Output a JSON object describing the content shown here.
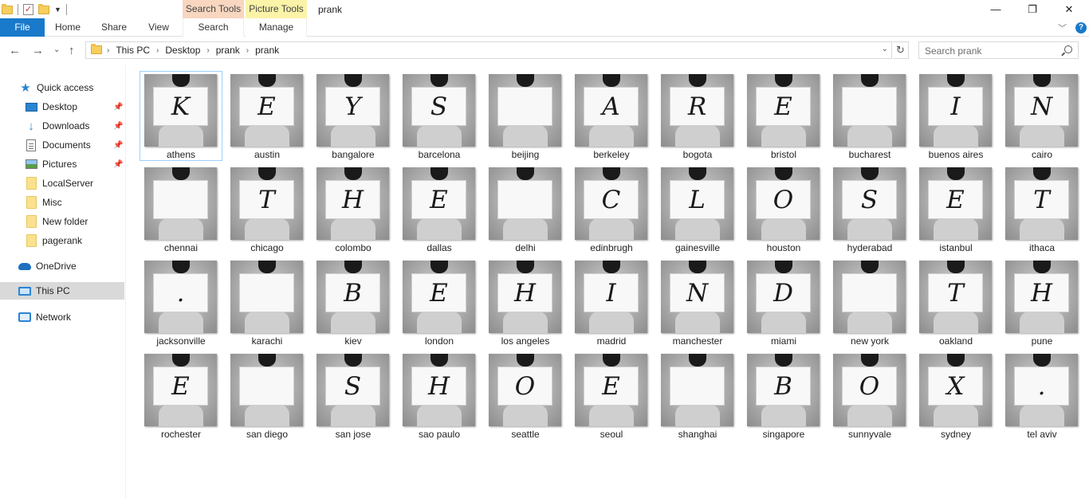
{
  "window": {
    "title": "prank",
    "context_search": "Search Tools",
    "context_picture": "Picture Tools",
    "minimize_icon": "minimize-icon",
    "maximize_icon": "restore-icon",
    "close_icon": "close-icon"
  },
  "ribbon": {
    "tabs": {
      "file": "File",
      "home": "Home",
      "share": "Share",
      "view": "View",
      "search": "Search",
      "manage": "Manage"
    }
  },
  "address": {
    "crumbs": [
      "This PC",
      "Desktop",
      "prank",
      "prank"
    ]
  },
  "search": {
    "placeholder": "Search prank"
  },
  "nav": {
    "quick_access": "Quick access",
    "desktop": "Desktop",
    "downloads": "Downloads",
    "documents": "Documents",
    "pictures": "Pictures",
    "localserver": "LocalServer",
    "misc": "Misc",
    "new_folder": "New folder",
    "pagerank": "pagerank",
    "onedrive": "OneDrive",
    "this_pc": "This PC",
    "network": "Network"
  },
  "files": [
    {
      "name": "athens",
      "letter": "K"
    },
    {
      "name": "austin",
      "letter": "E"
    },
    {
      "name": "bangalore",
      "letter": "Y"
    },
    {
      "name": "barcelona",
      "letter": "S"
    },
    {
      "name": "beijing",
      "letter": ""
    },
    {
      "name": "berkeley",
      "letter": "A"
    },
    {
      "name": "bogota",
      "letter": "R"
    },
    {
      "name": "bristol",
      "letter": "E"
    },
    {
      "name": "bucharest",
      "letter": ""
    },
    {
      "name": "buenos aires",
      "letter": "I"
    },
    {
      "name": "cairo",
      "letter": "N"
    },
    {
      "name": "chennai",
      "letter": ""
    },
    {
      "name": "chicago",
      "letter": "T"
    },
    {
      "name": "colombo",
      "letter": "H"
    },
    {
      "name": "dallas",
      "letter": "E"
    },
    {
      "name": "delhi",
      "letter": ""
    },
    {
      "name": "edinbrugh",
      "letter": "C"
    },
    {
      "name": "gainesville",
      "letter": "L"
    },
    {
      "name": "houston",
      "letter": "O"
    },
    {
      "name": "hyderabad",
      "letter": "S"
    },
    {
      "name": "istanbul",
      "letter": "E"
    },
    {
      "name": "ithaca",
      "letter": "T"
    },
    {
      "name": "jacksonville",
      "letter": "."
    },
    {
      "name": "karachi",
      "letter": ""
    },
    {
      "name": "kiev",
      "letter": "B"
    },
    {
      "name": "london",
      "letter": "E"
    },
    {
      "name": "los angeles",
      "letter": "H"
    },
    {
      "name": "madrid",
      "letter": "I"
    },
    {
      "name": "manchester",
      "letter": "N"
    },
    {
      "name": "miami",
      "letter": "D"
    },
    {
      "name": "new york",
      "letter": ""
    },
    {
      "name": "oakland",
      "letter": "T"
    },
    {
      "name": "pune",
      "letter": "H"
    },
    {
      "name": "rochester",
      "letter": "E"
    },
    {
      "name": "san diego",
      "letter": ""
    },
    {
      "name": "san jose",
      "letter": "S"
    },
    {
      "name": "sao paulo",
      "letter": "H"
    },
    {
      "name": "seattle",
      "letter": "O"
    },
    {
      "name": "seoul",
      "letter": "E"
    },
    {
      "name": "shanghai",
      "letter": ""
    },
    {
      "name": "singapore",
      "letter": "B"
    },
    {
      "name": "sunnyvale",
      "letter": "O"
    },
    {
      "name": "sydney",
      "letter": "X"
    },
    {
      "name": "tel aviv",
      "letter": "."
    }
  ],
  "selected_file": "athens"
}
